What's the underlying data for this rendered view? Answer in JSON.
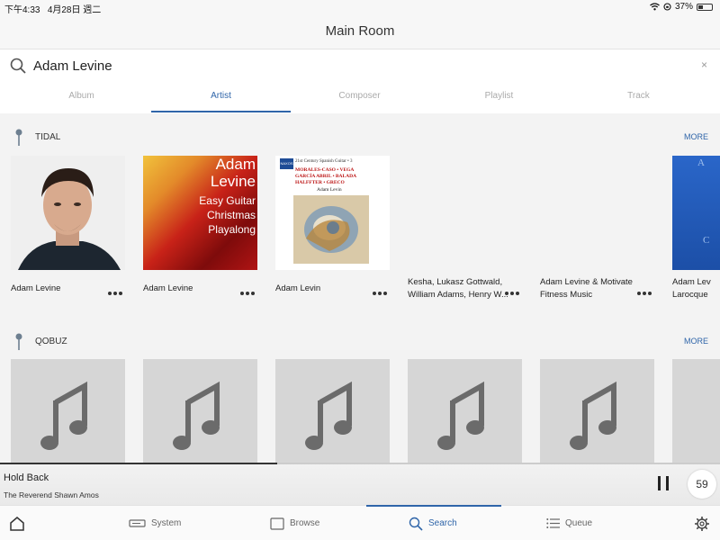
{
  "status_bar": {
    "time": "下午4:33",
    "date": "4月28日 週二",
    "battery": "37%",
    "battery_level": 0.37
  },
  "header": {
    "title": "Main Room"
  },
  "search": {
    "value": "Adam Levine",
    "clear": "×"
  },
  "tabs": [
    {
      "label": "Album",
      "active": false
    },
    {
      "label": "Artist",
      "active": true
    },
    {
      "label": "Composer",
      "active": false
    },
    {
      "label": "Playlist",
      "active": false
    },
    {
      "label": "Track",
      "active": false
    }
  ],
  "sections": [
    {
      "title": "TIDAL",
      "more": "MORE",
      "cards": [
        {
          "line1": "Adam Levine",
          "line2": ""
        },
        {
          "line1": "Adam Levine",
          "line2": "",
          "art_text": [
            "Adam",
            "Levine",
            "Easy Guitar",
            "Christmas",
            "Playalong"
          ]
        },
        {
          "line1": "Adam Levin",
          "line2": "",
          "art_text": [
            "21st Century Spanish Guitar • 3",
            "MORALES-CASO • VEGA",
            "GARCÍA ABRIL • BALADA",
            "HALFFTER • GRECO",
            "Adam Levin"
          ],
          "logo": "NAXOS"
        },
        {
          "line1": "Kesha, Lukasz Gottwald,",
          "line2": "William Adams, Henry W..."
        },
        {
          "line1": "Adam Levine & Motivate",
          "line2": "Fitness Music"
        },
        {
          "line1": "Adam Lev",
          "line2": "Larocque",
          "art_text": [
            "A",
            "C"
          ]
        }
      ]
    },
    {
      "title": "QOBUZ",
      "more": "MORE",
      "cards": [
        {},
        {},
        {},
        {},
        {},
        {}
      ]
    }
  ],
  "now_playing": {
    "title": "Hold Back",
    "artist": "The Reverend Shawn Amos",
    "progress": 0.385,
    "volume": "59"
  },
  "bottom_nav": [
    {
      "label": "",
      "icon": "home-icon"
    },
    {
      "label": "System",
      "icon": "system-icon"
    },
    {
      "label": "Browse",
      "icon": "browse-icon"
    },
    {
      "label": "Search",
      "icon": "search-icon",
      "active": true
    },
    {
      "label": "Queue",
      "icon": "queue-icon"
    },
    {
      "label": "",
      "icon": "gear-icon"
    }
  ],
  "colors": {
    "accent": "#2f65a9"
  }
}
